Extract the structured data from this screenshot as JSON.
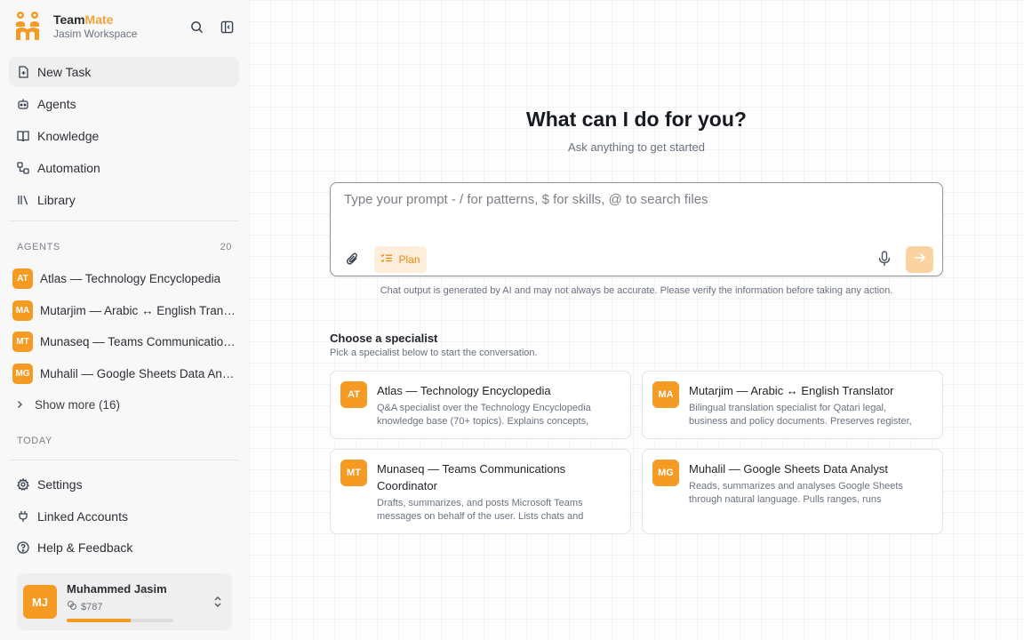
{
  "brand": {
    "name_part1": "Team",
    "name_part2": "Mate",
    "workspace": "Jasim Workspace"
  },
  "nav": [
    {
      "label": "New Task",
      "icon": "new-task-icon"
    },
    {
      "label": "Agents",
      "icon": "robot-icon"
    },
    {
      "label": "Knowledge",
      "icon": "book-icon"
    },
    {
      "label": "Automation",
      "icon": "workflow-icon"
    },
    {
      "label": "Library",
      "icon": "library-icon"
    }
  ],
  "agents_section": {
    "title": "AGENTS",
    "count": "20",
    "items": [
      {
        "badge": "AT",
        "name": "Atlas — Technology Encyclopedia"
      },
      {
        "badge": "MA",
        "name": "Mutarjim — Arabic ↔ English Translator"
      },
      {
        "badge": "MT",
        "name": "Munaseq — Teams Communications Coordinator"
      },
      {
        "badge": "MG",
        "name": "Muhalil — Google Sheets Data Analyst"
      }
    ],
    "show_more": "Show more (16)"
  },
  "today_label": "TODAY",
  "bottom_nav": [
    {
      "label": "Settings",
      "icon": "gear-icon"
    },
    {
      "label": "Linked Accounts",
      "icon": "plug-icon"
    },
    {
      "label": "Help & Feedback",
      "icon": "help-icon"
    }
  ],
  "user": {
    "initials": "MJ",
    "name": "Muhammed Jasim",
    "credits": "$787",
    "usage_fraction": 0.6
  },
  "main": {
    "headline": "What can I do for you?",
    "subline": "Ask anything to get started",
    "prompt_placeholder": "Type your prompt - / for patterns, $ for skills, @ to search files",
    "plan_label": "Plan",
    "disclaimer": "Chat output is generated by AI and may not always be accurate. Please verify the information before taking any action.",
    "specialists_title": "Choose a specialist",
    "specialists_sub": "Pick a specialist below to start the conversation.",
    "specialists": [
      {
        "badge": "AT",
        "title": "Atlas — Technology Encyclopedia",
        "desc": "Q&A specialist over the Technology Encyclopedia knowledge base (70+ topics). Explains concepts, compares technologies and more."
      },
      {
        "badge": "MA",
        "title": "Mutarjim — Arabic ↔ English Translator",
        "desc": "Bilingual translation specialist for Qatari legal, business and policy documents. Preserves register, terminology and tone."
      },
      {
        "badge": "MT",
        "title": "Munaseq — Teams Communications Coordinator",
        "desc": "Drafts, summarizes, and posts Microsoft Teams messages on behalf of the user. Lists chats and channels."
      },
      {
        "badge": "MG",
        "title": "Muhalil — Google Sheets Data Analyst",
        "desc": "Reads, summarizes and analyses Google Sheets through natural language. Pulls ranges, runs calculations."
      }
    ]
  },
  "colors": {
    "accent": "#f59a22",
    "accent_light": "#fdeedb",
    "send_disabled": "#fbd3a0"
  }
}
